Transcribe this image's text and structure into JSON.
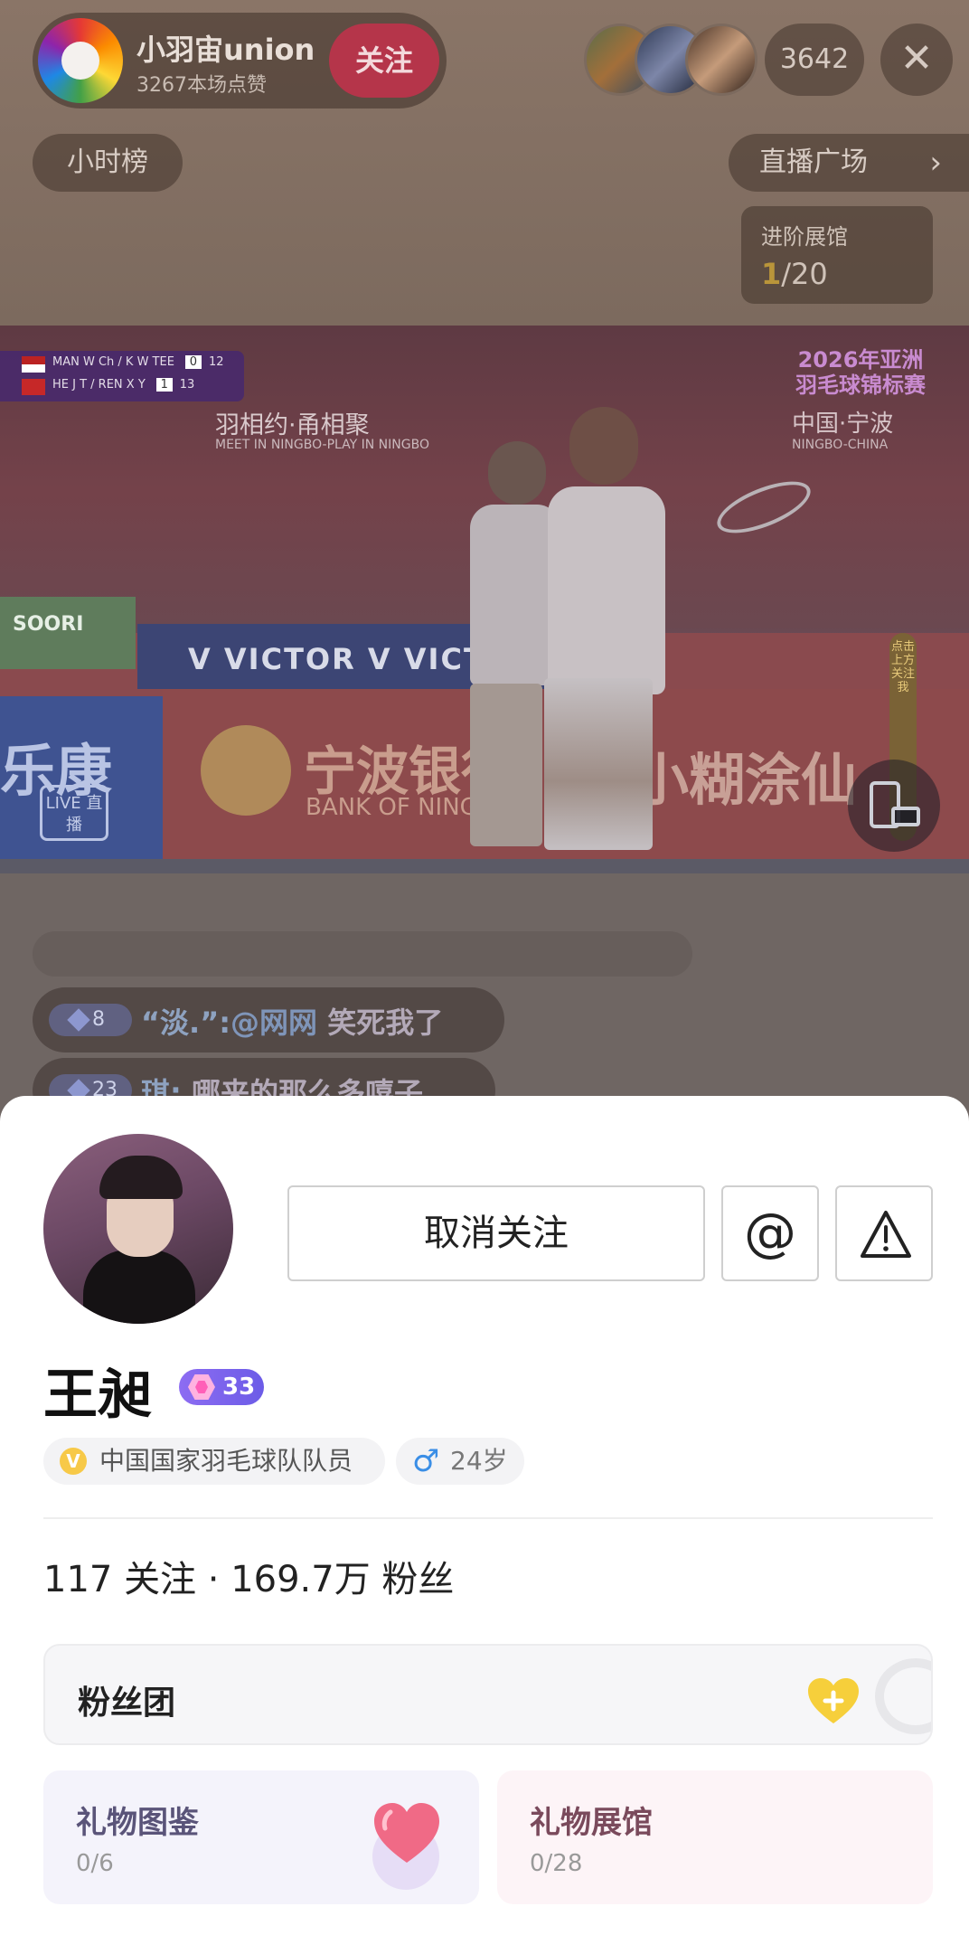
{
  "live": {
    "host_name": "小羽宙union",
    "host_likes": "3267本场点赞",
    "follow_label": "关注",
    "viewer_count": "3642",
    "close_symbol": "✕",
    "hour_rank_label": "小时榜",
    "plaza_label": "直播广场",
    "advance": {
      "title": "进阶展馆",
      "current": "1",
      "total": "/20"
    }
  },
  "video": {
    "scoreboard": [
      {
        "names": "MAN W Ch / K W TEE",
        "games": "0",
        "points": "12"
      },
      {
        "names": "HE J T / REN X Y",
        "games": "1",
        "points": "13"
      }
    ],
    "slogan": "羽相约·甬相聚",
    "slogan_sub": "MEET IN NINGBO-PLAY IN NINGBO",
    "event_logo": "2026年亚洲羽毛球锦标赛",
    "event_city": "中国·宁波",
    "event_city_sub": "NINGBO-CHINA",
    "board_victor": "V VICTOR  V VICT",
    "board_green": "SOORI",
    "bank_name": "宁波银行",
    "bank_en": "BANK OF NINGBO",
    "shop_name": "小糊涂仙",
    "blue_board": "乐康",
    "live_badge": "LIVE 直播",
    "side_strip": "点击上方关注我"
  },
  "comments": [
    {
      "level": "8",
      "user": "“淡.”:",
      "mention": "@网网",
      "text": " 笑死我了"
    },
    {
      "level": "23",
      "user": "琪:",
      "mention": "",
      "text": " 哪来的那么多嘻子"
    }
  ],
  "profile": {
    "unfollow_label": "取消关注",
    "mention_symbol": "@",
    "name": "王昶",
    "level": "33",
    "verify_icon": "V",
    "verify_text": "中国国家羽毛球队队员",
    "gender_symbol": "♂",
    "age": "24岁",
    "stats": "117 关注 · 169.7万 粉丝",
    "fans_club_label": "粉丝团",
    "gift_catalog": {
      "title": "礼物图鉴",
      "count": "0/6"
    },
    "gift_hall": {
      "title": "礼物展馆",
      "count": "0/28"
    }
  },
  "colors": {
    "follow_button": "#b5354a",
    "level_badge": "#7b63ec",
    "verify_icon": "#f7c948",
    "male_icon": "#3a8ee6"
  },
  "icons": {
    "close": "close-icon",
    "plaza_chevron": "chevron-right-icon",
    "mention": "at-icon",
    "report": "warning-icon",
    "verify": "verified-icon",
    "gender": "male-icon",
    "fans_heart": "heart-plus-icon",
    "screen": "screen-rotate-icon"
  }
}
